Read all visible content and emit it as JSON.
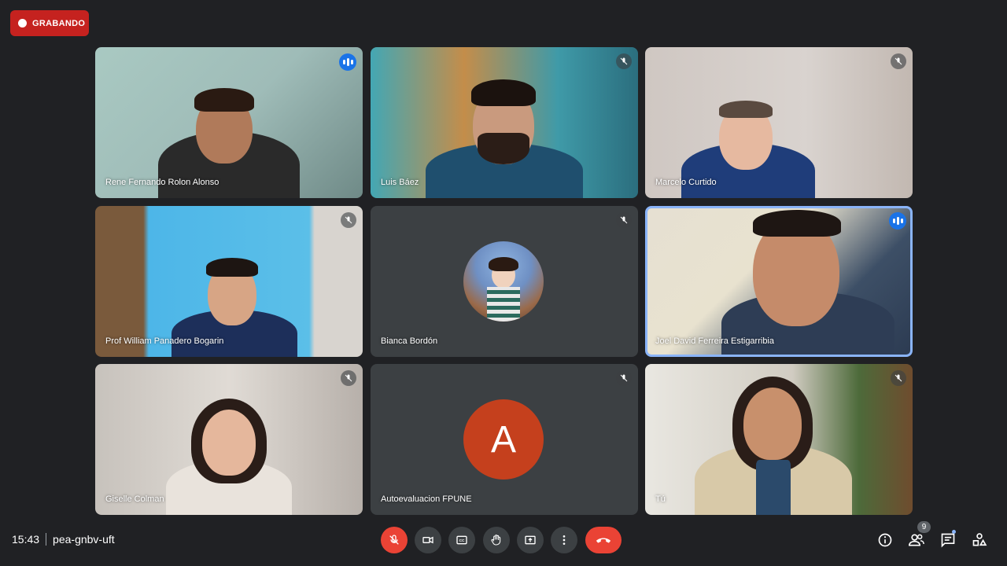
{
  "recording": {
    "label": "GRABANDO"
  },
  "participants": [
    {
      "name": "Rene Fernando Rolon Alonso",
      "state": "speaking"
    },
    {
      "name": "Luis Báez",
      "state": "muted"
    },
    {
      "name": "Marcelo Curtido",
      "state": "muted"
    },
    {
      "name": "Prof William Panadero Bogarin",
      "state": "muted"
    },
    {
      "name": "Bianca Bordón",
      "state": "muted"
    },
    {
      "name": "Joel David Ferreira Estigarribia",
      "state": "speaking"
    },
    {
      "name": "Giselle Colman",
      "state": "muted"
    },
    {
      "name": "Autoevaluacion FPUNE",
      "state": "muted",
      "avatar_letter": "A"
    },
    {
      "name": "Tú",
      "state": "muted"
    }
  ],
  "meeting": {
    "time": "15:43",
    "code": "pea-gnbv-uft"
  },
  "people_count": "9",
  "colors": {
    "background": "#202124",
    "recording": "#c5221f",
    "speaking": "#1a73e8",
    "end_call": "#ea4335",
    "avatar_a": "#c5401d"
  },
  "icons": [
    "mic-off-icon",
    "camera-icon",
    "captions-icon",
    "raise-hand-icon",
    "present-icon",
    "more-vert-icon",
    "end-call-icon",
    "info-icon",
    "people-icon",
    "chat-icon",
    "activities-icon"
  ]
}
